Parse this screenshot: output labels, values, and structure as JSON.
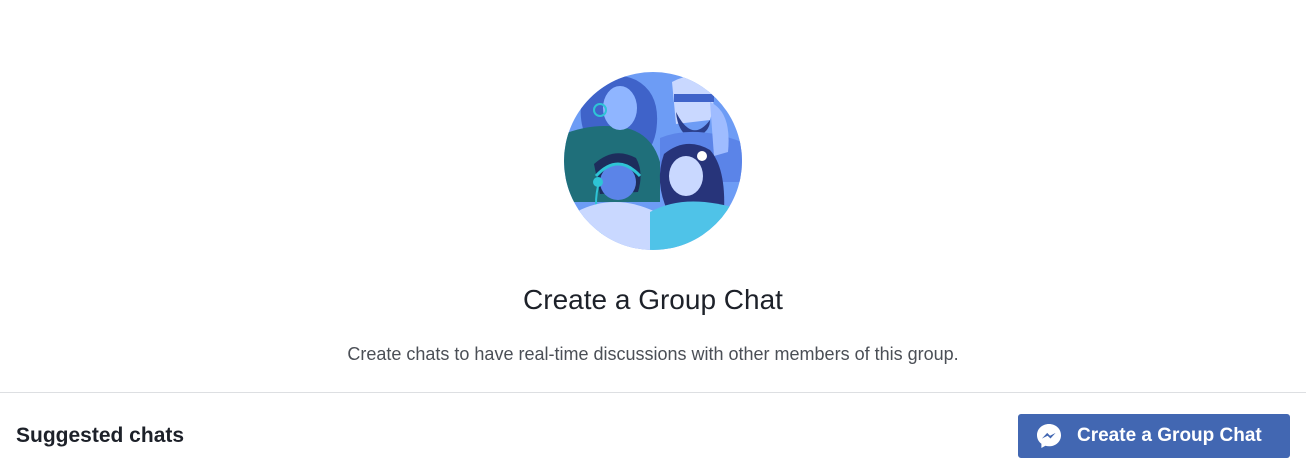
{
  "empty_state": {
    "illustration_icon": "group-of-people-illustration",
    "title": "Create a Group Chat",
    "description": "Create chats to have real-time discussions with other members of this group."
  },
  "footer": {
    "section_heading": "Suggested chats",
    "create_button_label": "Create a Group Chat",
    "create_button_icon": "messenger-icon"
  },
  "colors": {
    "button_background": "#4267b2",
    "illustration_background": "#6d9cf5",
    "divider": "#dddfe2"
  }
}
